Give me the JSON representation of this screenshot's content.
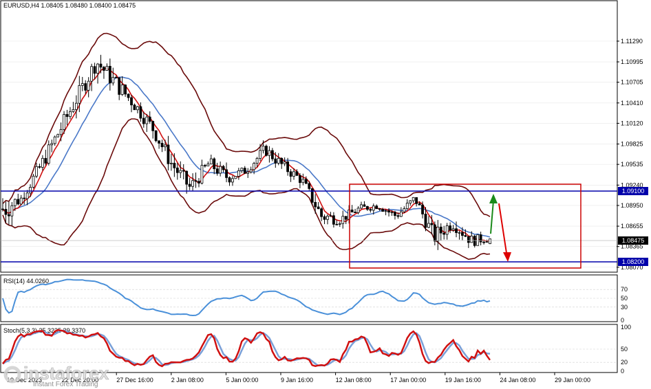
{
  "chart_data": {
    "type": "candlestick",
    "title": "EURUSD,H4 1.08405 1.08480 1.08400 1.08475",
    "price_axis": {
      "ticks": [
        "1.11290",
        "1.10995",
        "1.10705",
        "1.10410",
        "1.10120",
        "1.09825",
        "1.09535",
        "1.09240",
        "1.08950",
        "1.08655",
        "1.08365",
        "1.08070"
      ],
      "range": [
        1.08,
        1.117
      ]
    },
    "time_axis": {
      "labels": [
        "19 Dec 2023",
        "22 Dec 20:00",
        "27 Dec 16:00",
        "2 Jan 08:00",
        "5 Jan 00:00",
        "9 Jan 16:00",
        "12 Jan 08:00",
        "17 Jan 00:00",
        "19 Jan 16:00",
        "24 Jan 08:00",
        "29 Jan 00:00"
      ]
    },
    "levels": [
      {
        "price": 1.091,
        "label": "1.09100",
        "color": "#0000aa"
      },
      {
        "price": 1.082,
        "label": "1.08200",
        "color": "#0000aa"
      }
    ],
    "current_price": {
      "price": 1.08475,
      "label": "1.08475"
    },
    "range_box": {
      "from": "17 Jan 00:00",
      "to": "29 Jan 00:00",
      "high": 1.0914,
      "low": 1.0816,
      "color": "#cc0000"
    },
    "arrows": [
      {
        "direction": "up",
        "color": "#1a8a1a"
      },
      {
        "direction": "down",
        "color": "#dd0000"
      }
    ],
    "ohlc_sample": [
      [
        1.0972,
        1.1,
        1.087,
        1.089
      ],
      [
        1.089,
        1.092,
        1.088,
        1.0905
      ],
      [
        1.0905,
        1.096,
        1.09,
        1.095
      ],
      [
        1.095,
        1.101,
        1.094,
        1.1
      ],
      [
        1.1,
        1.106,
        1.099,
        1.105
      ],
      [
        1.105,
        1.111,
        1.104,
        1.11
      ],
      [
        1.11,
        1.1135,
        1.106,
        1.107
      ],
      [
        1.107,
        1.108,
        1.102,
        1.104
      ],
      [
        1.104,
        1.105,
        1.099,
        1.1005
      ],
      [
        1.1005,
        1.101,
        1.094,
        1.0955
      ],
      [
        1.0955,
        1.0965,
        1.09,
        1.092
      ],
      [
        1.092,
        1.0965,
        1.091,
        1.0955
      ],
      [
        1.0955,
        1.0975,
        1.092,
        1.0935
      ],
      [
        1.0935,
        1.096,
        1.0925,
        1.0945
      ],
      [
        1.0945,
        1.0985,
        1.0935,
        1.0975
      ],
      [
        1.0975,
        1.099,
        1.094,
        1.095
      ],
      [
        1.095,
        1.096,
        1.092,
        1.093
      ],
      [
        1.093,
        1.0935,
        1.087,
        1.088
      ],
      [
        1.088,
        1.09,
        1.086,
        1.0875
      ],
      [
        1.0875,
        1.09,
        1.0865,
        1.089
      ],
      [
        1.089,
        1.091,
        1.088,
        1.0895
      ],
      [
        1.0895,
        1.091,
        1.0875,
        1.088
      ],
      [
        1.088,
        1.0915,
        1.0875,
        1.0905
      ],
      [
        1.0905,
        1.0915,
        1.084,
        1.085
      ],
      [
        1.085,
        1.088,
        1.083,
        1.087
      ],
      [
        1.087,
        1.088,
        1.083,
        1.0845
      ],
      [
        1.0845,
        1.0855,
        1.083,
        1.0848
      ]
    ],
    "rsi": {
      "label": "RSI(14) 44.0260",
      "levels": [
        "70",
        "50",
        "30",
        "0"
      ],
      "last": 44.026
    },
    "stochastic": {
      "label": "Stoch(5,3,3) 25.3235 39.3370",
      "levels": [
        "100",
        "50",
        "20",
        "0"
      ],
      "main": 25.3235,
      "signal": 39.337
    }
  },
  "watermark": {
    "brand": "instaforex",
    "tagline": "Instant Forex Trading"
  }
}
